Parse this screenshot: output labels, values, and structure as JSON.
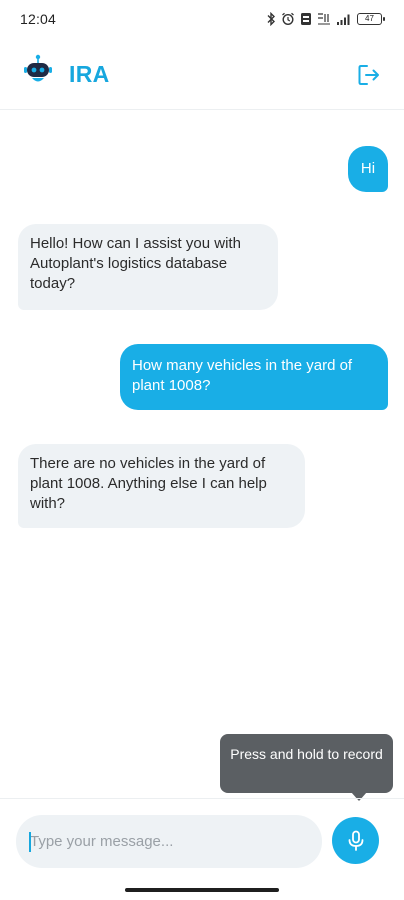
{
  "status_bar": {
    "time": "12:04",
    "battery": "47",
    "icons": [
      "bluetooth-icon",
      "alarm-icon",
      "data-saver-icon",
      "hd-4g-icon",
      "signal-icon",
      "battery-icon"
    ]
  },
  "header": {
    "title": "IRA",
    "logo_icon": "robot-icon",
    "logout_icon": "logout-icon"
  },
  "messages": [
    {
      "sender": "user",
      "text": "Hi"
    },
    {
      "sender": "bot",
      "text": "Hello! How can I assist you with Autoplant's logistics database today?"
    },
    {
      "sender": "user",
      "text": "How many vehicles in the yard of plant 1008?"
    },
    {
      "sender": "bot",
      "text": "There are no vehicles in the yard of plant 1008. Anything else I can help with?"
    }
  ],
  "tooltip": {
    "text": "Press and hold to record"
  },
  "composer": {
    "placeholder": "Type your message...",
    "value": "",
    "mic_icon": "microphone-icon"
  },
  "colors": {
    "accent": "#19aee6",
    "bot_bubble": "#eef2f5",
    "tooltip": "#5b5f63"
  }
}
